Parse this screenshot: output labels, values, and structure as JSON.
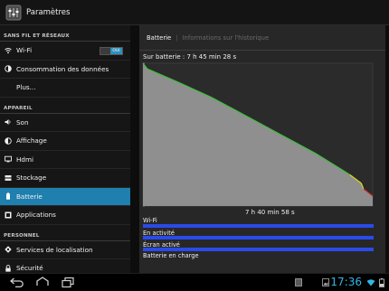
{
  "app": {
    "title": "Paramètres"
  },
  "sidebar": {
    "sections": [
      {
        "header": "SANS FIL ET RÉSEAUX",
        "items": [
          {
            "label": "Wi-Fi",
            "icon": "wifi-icon",
            "toggle": "OUI"
          },
          {
            "label": "Consommation des données",
            "icon": "data-usage-icon"
          },
          {
            "label": "Plus...",
            "icon": ""
          }
        ]
      },
      {
        "header": "APPAREIL",
        "items": [
          {
            "label": "Son",
            "icon": "speaker-icon"
          },
          {
            "label": "Affichage",
            "icon": "brightness-icon"
          },
          {
            "label": "Hdmi",
            "icon": "hdmi-icon"
          },
          {
            "label": "Stockage",
            "icon": "storage-icon"
          },
          {
            "label": "Batterie",
            "icon": "battery-icon",
            "active": true
          },
          {
            "label": "Applications",
            "icon": "apps-icon"
          }
        ]
      },
      {
        "header": "PERSONNEL",
        "items": [
          {
            "label": "Services de localisation",
            "icon": "location-icon"
          },
          {
            "label": "Sécurité",
            "icon": "lock-icon"
          }
        ]
      }
    ]
  },
  "tabs": {
    "active": "Batterie",
    "inactive": "Informations sur l'historique"
  },
  "battery": {
    "since_label": "Sur batterie : 7 h 45 min 28 s",
    "duration_label": "7 h 40 min 58 s",
    "stats": [
      "Wi-Fi",
      "En activité",
      "Écran activé",
      "Batterie en charge"
    ]
  },
  "chart_data": {
    "type": "area",
    "title": "Sur batterie : 7 h 45 min 28 s",
    "x_unit": "fraction of elapsed time",
    "y_unit": "battery level (%)",
    "x": [
      0,
      0.02,
      0.15,
      0.3,
      0.45,
      0.6,
      0.75,
      0.9,
      0.95,
      0.96,
      1.0
    ],
    "y": [
      100,
      96,
      87,
      76,
      63,
      50,
      37,
      22,
      16,
      12,
      7
    ],
    "ylim": [
      0,
      100
    ],
    "colors": {
      "fill": "#8f8f8f",
      "line_high": "#3fbf3f",
      "line_mid": "#d8d820",
      "line_low": "#e02a2a"
    }
  },
  "status": {
    "time": "17:36"
  },
  "colors": {
    "accent": "#33b5e5",
    "selection": "#1f7fae",
    "usage_bar": "#2a4be8"
  }
}
